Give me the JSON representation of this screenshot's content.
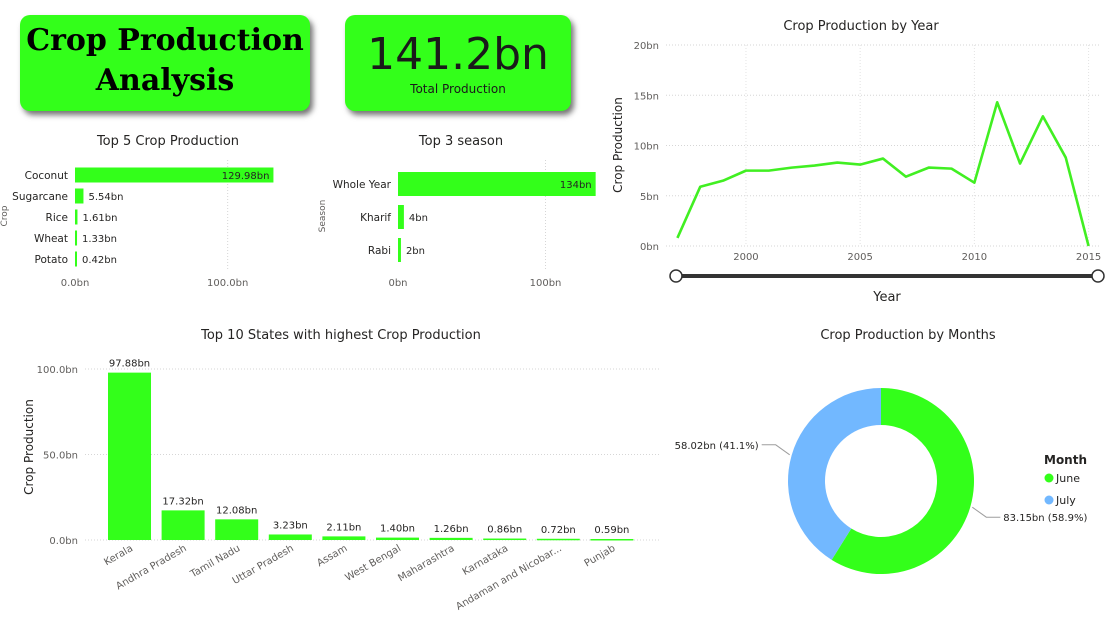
{
  "title": "Crop Production Analysis",
  "title_lines": [
    "Crop Production",
    "Analysis"
  ],
  "kpi": {
    "value": "141.2bn",
    "label": "Total Production"
  },
  "colors": {
    "accent": "#33ff1a",
    "bar": "#33ff1a",
    "line": "#41ef22",
    "june": "#33ff1a",
    "july": "#72b8ff"
  },
  "chart_data": [
    {
      "id": "top5-crops",
      "type": "bar",
      "orientation": "horizontal",
      "title": "Top 5 Crop Production",
      "ylabel": "Crop",
      "categories": [
        "Coconut",
        "Sugarcane",
        "Rice",
        "Wheat",
        "Potato"
      ],
      "values": [
        129.98,
        5.54,
        1.61,
        1.33,
        0.42
      ],
      "labels": [
        "129.98bn",
        "5.54bn",
        "1.61bn",
        "1.33bn",
        "0.42bn"
      ],
      "xticks": [
        "0.0bn",
        "100.0bn"
      ],
      "xlim": [
        0,
        150
      ],
      "grid": true
    },
    {
      "id": "top3-season",
      "type": "bar",
      "orientation": "horizontal",
      "title": "Top 3 season",
      "ylabel": "Season",
      "categories": [
        "Whole Year",
        "Kharif",
        "Rabi"
      ],
      "values": [
        134,
        4,
        2
      ],
      "labels": [
        "134bn",
        "4bn",
        "2bn"
      ],
      "xticks": [
        "0bn",
        "100bn"
      ],
      "xlim": [
        0,
        200
      ],
      "grid": true
    },
    {
      "id": "production-by-year",
      "type": "line",
      "title": "Crop Production by Year",
      "xlabel": "Year",
      "ylabel": "Crop Production",
      "x": [
        1997,
        1998,
        1999,
        2000,
        2001,
        2002,
        2003,
        2004,
        2005,
        2006,
        2007,
        2008,
        2009,
        2010,
        2011,
        2012,
        2013,
        2014,
        2015
      ],
      "values": [
        0.8,
        5.9,
        6.5,
        7.5,
        7.5,
        7.8,
        8.0,
        8.3,
        8.1,
        8.7,
        6.9,
        7.8,
        7.7,
        6.3,
        14.3,
        8.2,
        12.9,
        8.8,
        0.0
      ],
      "xticks": [
        "2000",
        "2005",
        "2010",
        "2015"
      ],
      "yticks": [
        "0bn",
        "5bn",
        "10bn",
        "15bn",
        "20bn"
      ],
      "xlim": [
        1996.5,
        2015.5
      ],
      "ylim": [
        0,
        20
      ],
      "grid": true
    },
    {
      "id": "top10-states",
      "type": "bar",
      "title": "Top 10 States with highest Crop Production",
      "ylabel": "Crop Production",
      "categories": [
        "Kerala",
        "Andhra Pradesh",
        "Tamil Nadu",
        "Uttar Pradesh",
        "Assam",
        "West Bengal",
        "Maharashtra",
        "Karnataka",
        "Andaman and Nicobar...",
        "Punjab"
      ],
      "values": [
        97.88,
        17.32,
        12.08,
        3.23,
        2.11,
        1.4,
        1.26,
        0.86,
        0.72,
        0.59
      ],
      "labels": [
        "97.88bn",
        "17.32bn",
        "12.08bn",
        "3.23bn",
        "2.11bn",
        "1.40bn",
        "1.26bn",
        "0.86bn",
        "0.72bn",
        "0.59bn"
      ],
      "yticks": [
        "0.0bn",
        "50.0bn",
        "100.0bn"
      ],
      "ylim": [
        0,
        100
      ],
      "grid": true
    },
    {
      "id": "production-by-months",
      "type": "pie",
      "variant": "donut",
      "title": "Crop Production by Months",
      "legend_title": "Month",
      "legend_position": "right",
      "categories": [
        "June",
        "July"
      ],
      "values": [
        83.15,
        58.02
      ],
      "labels": [
        "83.15bn (58.9%)",
        "58.02bn (41.1%)"
      ]
    }
  ]
}
